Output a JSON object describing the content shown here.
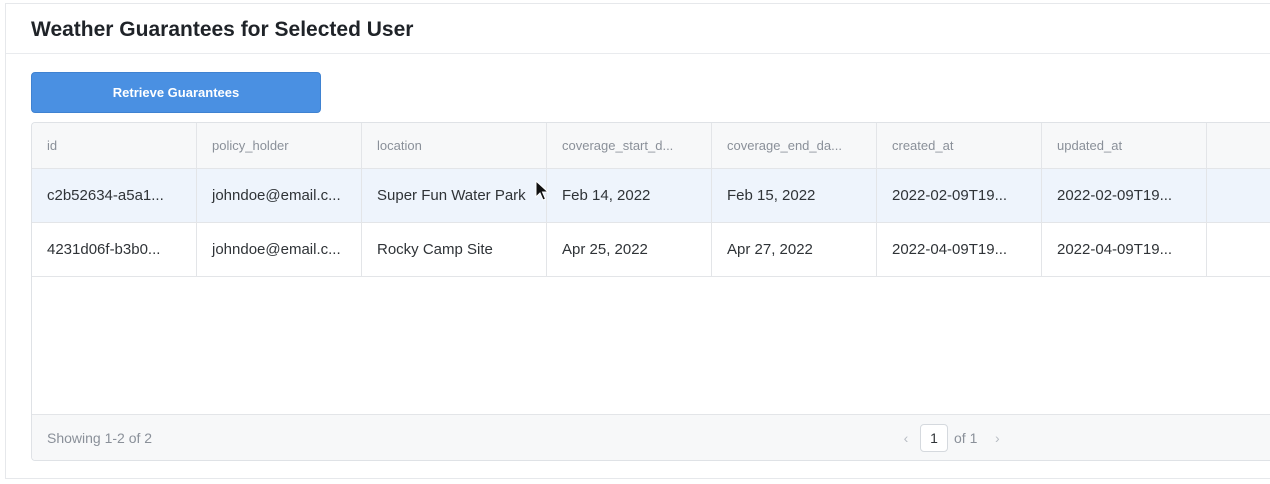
{
  "panel": {
    "title": "Weather Guarantees for Selected User",
    "retrieve_label": "Retrieve Guarantees"
  },
  "table": {
    "columns": [
      "id",
      "policy_holder",
      "location",
      "coverage_start_d...",
      "coverage_end_da...",
      "created_at",
      "updated_at",
      ""
    ],
    "rows": [
      [
        "c2b52634-a5a1...",
        "johndoe@email.c...",
        "Super Fun Water Park",
        "Feb 14, 2022",
        "Feb 15, 2022",
        "2022-02-09T19...",
        "2022-02-09T19...",
        ""
      ],
      [
        "4231d06f-b3b0...",
        "johndoe@email.c...",
        "Rocky Camp Site",
        "Apr 25, 2022",
        "Apr 27, 2022",
        "2022-04-09T19...",
        "2022-04-09T19...",
        ""
      ]
    ],
    "footer": {
      "status": "Showing 1-2 of 2",
      "page_value": "1",
      "page_of": "of 1",
      "prev_icon": "chevron-left-icon",
      "next_icon": "chevron-right-icon"
    }
  },
  "colors": {
    "accent": "#4a90e2",
    "selected_row": "#eef4fc"
  }
}
